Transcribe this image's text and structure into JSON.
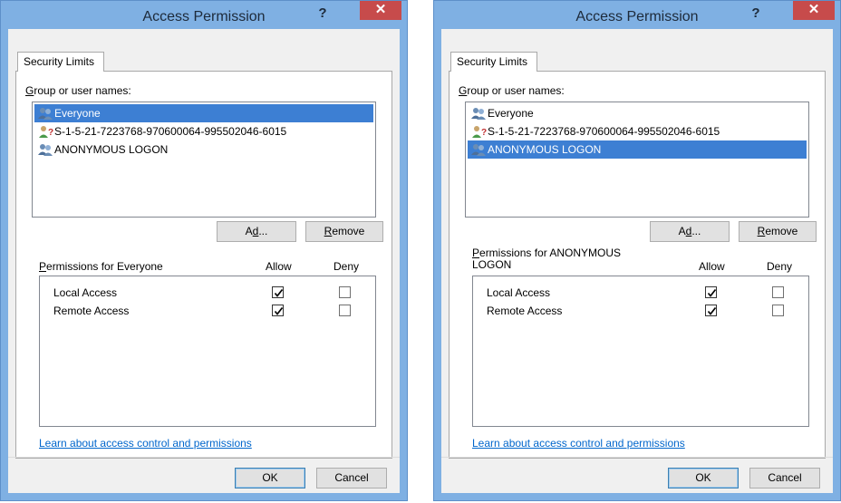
{
  "dialogs": [
    {
      "title": "Access Permission",
      "help": "?",
      "close": "✕",
      "tab": "Security Limits",
      "group_label": "Group or user names:",
      "group_label_key": "G",
      "group_label_rest": "roup or user names:",
      "users": [
        {
          "name": "Everyone",
          "selected": true
        },
        {
          "name": "S-1-5-21-7223768-970600064-995502046-6015",
          "selected": false
        },
        {
          "name": "ANONYMOUS LOGON",
          "selected": false
        }
      ],
      "add_key": "Add...",
      "add_a": "A",
      "add_u": "d",
      "add_rest": "d...",
      "remove_r": "R",
      "remove_rest": "emove",
      "perm_p": "P",
      "perm_rest1": "ermissions for Everyone",
      "perm_rest2": "",
      "allow": "Allow",
      "deny": "Deny",
      "permissions": [
        {
          "name": "Local Access",
          "allow": true,
          "deny": false
        },
        {
          "name": "Remote Access",
          "allow": true,
          "deny": false
        }
      ],
      "link": "Learn about access control and permissions",
      "ok": "OK",
      "cancel": "Cancel"
    },
    {
      "title": "Access Permission",
      "help": "?",
      "close": "✕",
      "tab": "Security Limits",
      "group_label_key": "G",
      "group_label_rest": "roup or user names:",
      "users": [
        {
          "name": "Everyone",
          "selected": false
        },
        {
          "name": "S-1-5-21-7223768-970600064-995502046-6015",
          "selected": false
        },
        {
          "name": "ANONYMOUS LOGON",
          "selected": true
        }
      ],
      "add_a": "A",
      "add_u": "d",
      "add_rest": "d...",
      "remove_r": "R",
      "remove_rest": "emove",
      "perm_p": "P",
      "perm_rest1": "ermissions for ANONYMOUS",
      "perm_rest2": "LOGON",
      "allow": "Allow",
      "deny": "Deny",
      "permissions": [
        {
          "name": "Local Access",
          "allow": true,
          "deny": false
        },
        {
          "name": "Remote Access",
          "allow": true,
          "deny": false
        }
      ],
      "link": "Learn about access control and permissions",
      "ok": "OK",
      "cancel": "Cancel"
    }
  ],
  "colors": {
    "frame": "#7fb0e3",
    "close": "#c74b4b",
    "selection": "#3d7fd3",
    "link": "#0066cc"
  },
  "icons": {
    "user_group": "users-group-icon",
    "unknown_user": "unknown-user-icon"
  }
}
